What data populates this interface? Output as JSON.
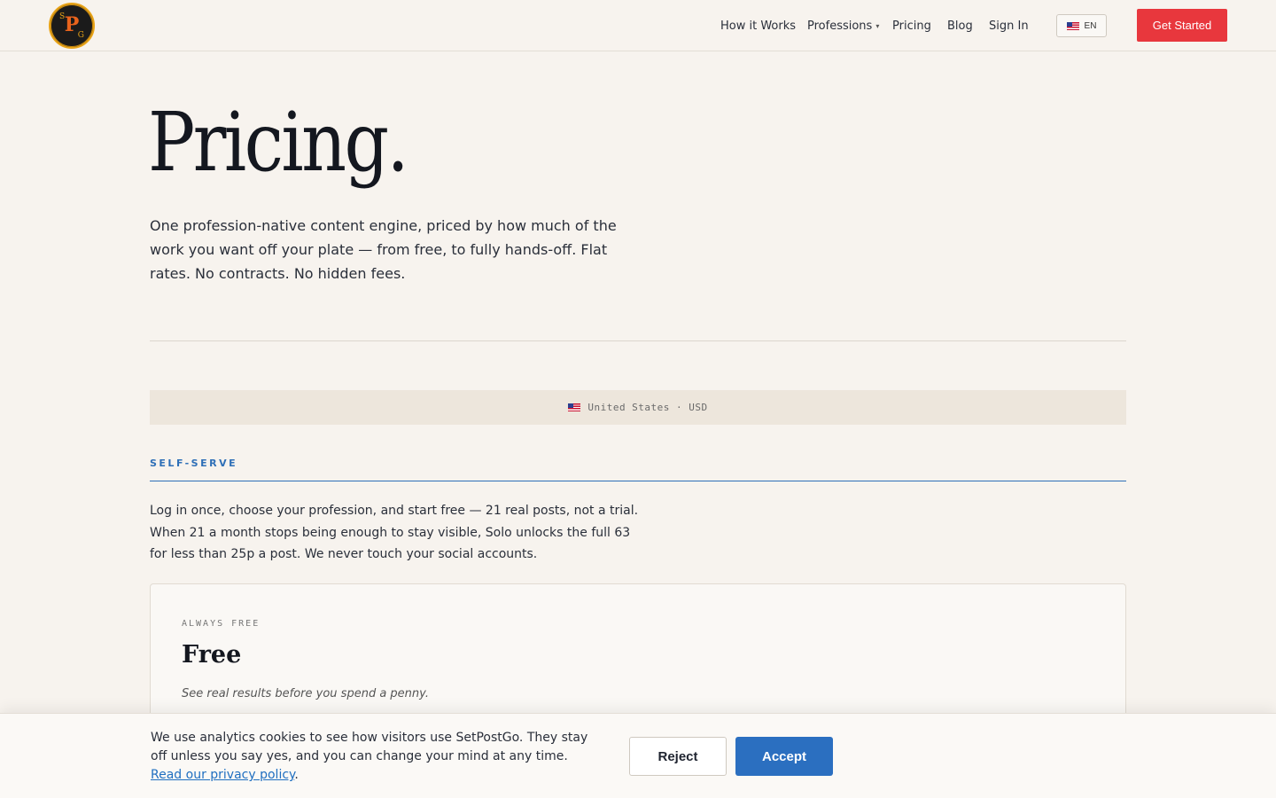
{
  "header": {
    "logo": {
      "main": "P",
      "left": "S",
      "right": "G"
    },
    "nav": {
      "how_it_works": "How it Works",
      "professions": "Professions",
      "professions_caret": "▾",
      "pricing": "Pricing",
      "blog": "Blog",
      "sign_in": "Sign In"
    },
    "language": {
      "code": "EN",
      "icon": "us-flag-icon"
    },
    "get_started": "Get Started"
  },
  "hero": {
    "title": "Pricing.",
    "subtitle": "One profession-native content engine, priced by how much of the work you want off your plate — from free, to fully hands-off. Flat rates. No contracts. No hidden fees."
  },
  "region": {
    "icon": "us-flag-icon",
    "label": "United States · USD"
  },
  "self_serve": {
    "label": "SELF-SERVE",
    "description": "Log in once, choose your profession, and start free — 21 real posts, not a trial. When 21 a month stops being enough to stay visible, Solo unlocks the full 63 for less than 25p a post. We never touch your social accounts."
  },
  "plan_free": {
    "eyebrow": "ALWAYS FREE",
    "title": "Free",
    "description": "See real results before you spend a penny."
  },
  "cookie_banner": {
    "text": "We use analytics cookies to see how visitors use SetPostGo. They stay off unless you say yes, and you can change your mind at any time. ",
    "link_text": "Read our privacy policy",
    "text_end": ".",
    "reject": "Reject",
    "accept": "Accept"
  },
  "colors": {
    "accent_red": "#e8373d",
    "accent_blue": "#2e6fb7",
    "background": "#f7f3ee"
  }
}
